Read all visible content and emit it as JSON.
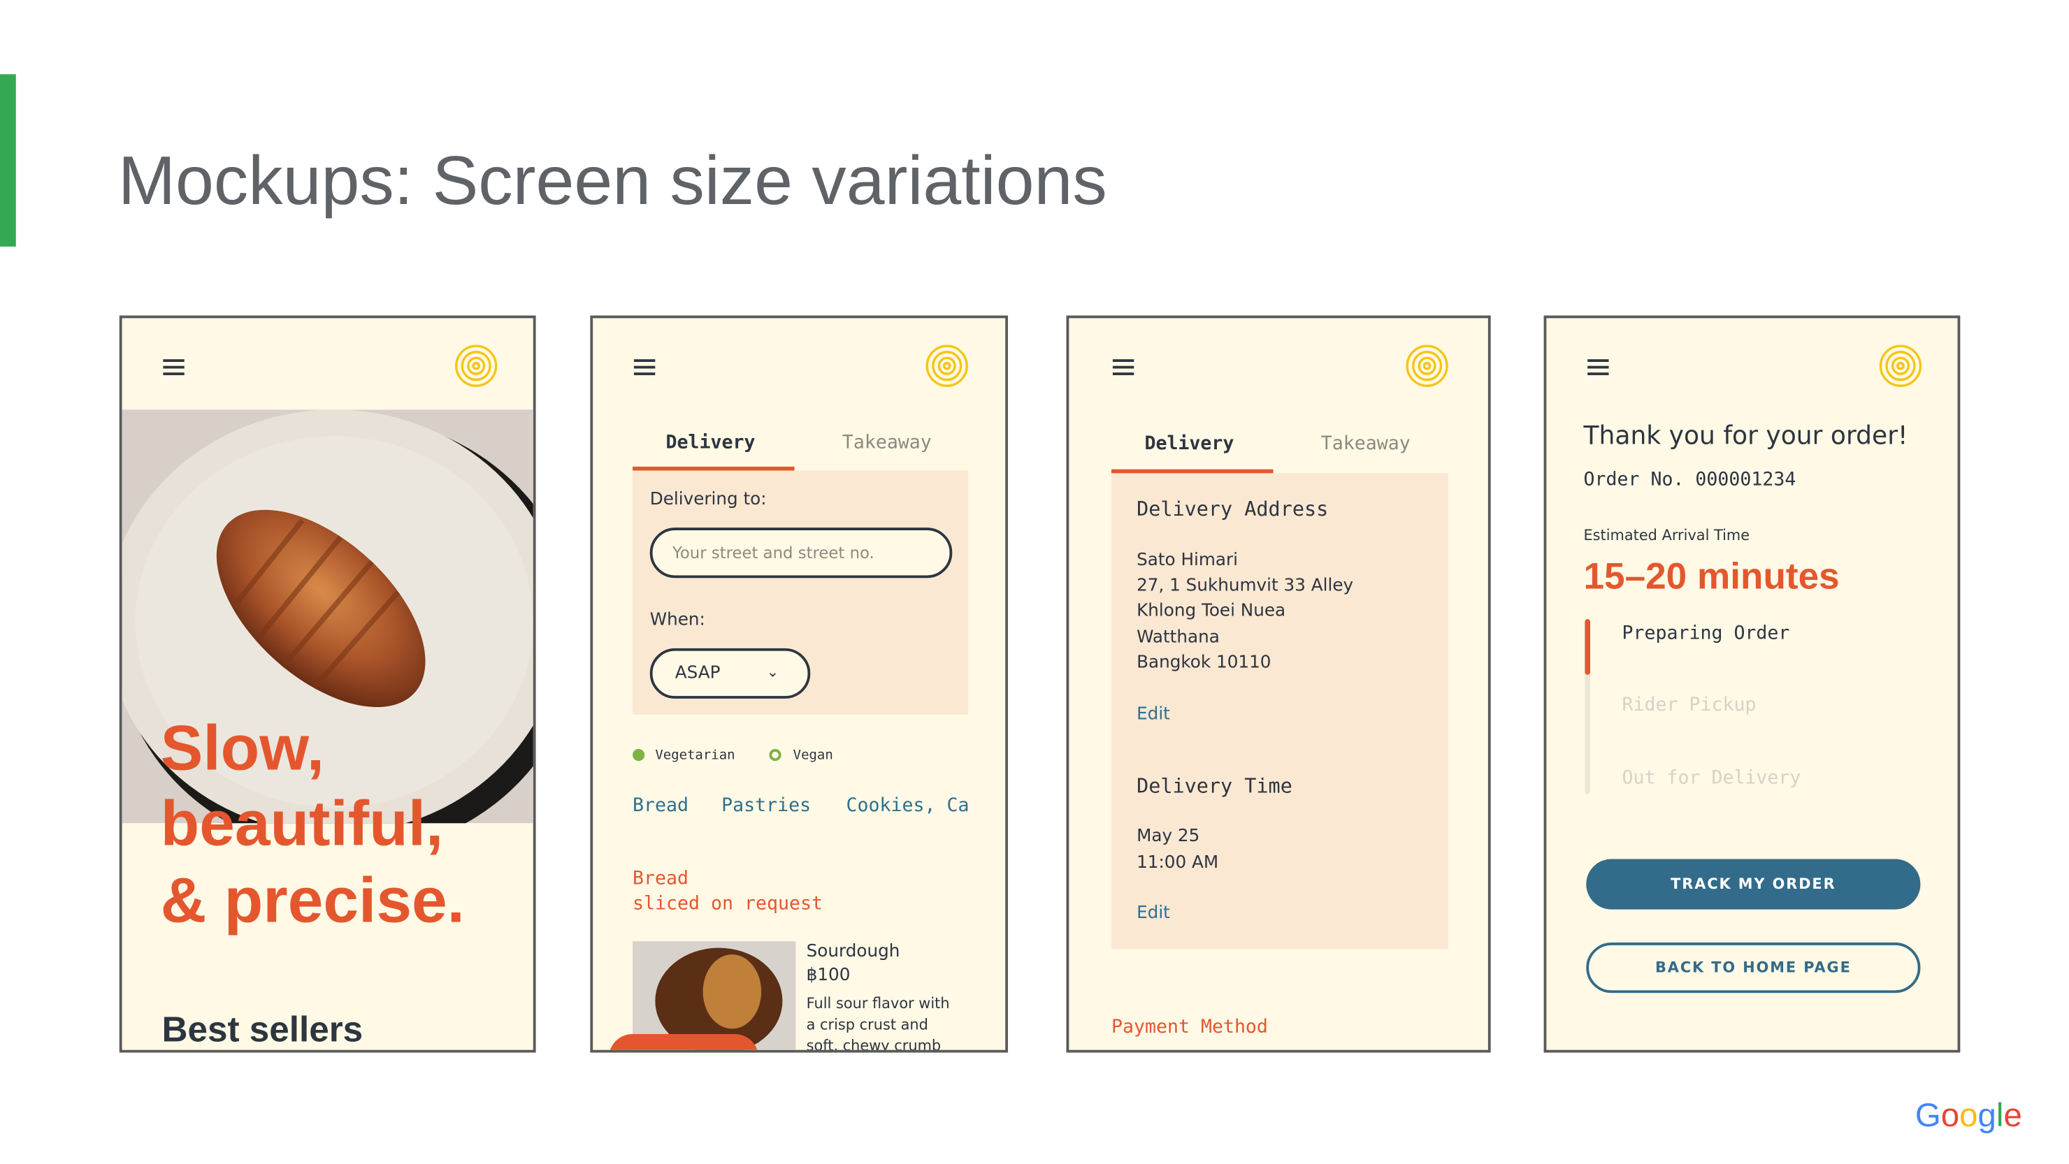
{
  "slide": {
    "title": "Mockups: Screen size variations",
    "accent_color": "#34a853",
    "footer_logo": "Google"
  },
  "colors": {
    "cream": "#fff9e6",
    "peach": "#fbe8d3",
    "orange": "#e4572e",
    "teal": "#336b8a",
    "logo_yellow": "#f5c518"
  },
  "phone1": {
    "menu_icon": "hamburger-icon",
    "logo_icon": "concentric-circles-logo",
    "hero_image": "croissant on plate",
    "headline": [
      "Slow,",
      "beautiful,",
      "& precise."
    ],
    "section_title": "Best sellers"
  },
  "phone2": {
    "tabs": [
      "Delivery",
      "Takeaway"
    ],
    "active_tab": "Delivery",
    "delivering_label": "Delivering to:",
    "address_placeholder": "Your street and street no.",
    "when_label": "When:",
    "when_value": "ASAP",
    "legend": [
      "Vegetarian",
      "Vegan"
    ],
    "categories": [
      "Bread",
      "Pastries",
      "Cookies, Ca"
    ],
    "section_title": "Bread",
    "section_subtitle": "sliced on request",
    "product": {
      "name": "Sourdough",
      "price": "฿100",
      "description": [
        "Full sour flavor with",
        "a crisp crust and",
        "soft, chewy crumb"
      ]
    }
  },
  "phone3": {
    "tabs": [
      "Delivery",
      "Takeaway"
    ],
    "active_tab": "Delivery",
    "address_heading": "Delivery Address",
    "address_lines": [
      "Sato Himari",
      "27, 1 Sukhumvit 33 Alley",
      "Khlong Toei Nuea",
      "Watthana",
      "Bangkok 10110"
    ],
    "edit_label": "Edit",
    "time_heading": "Delivery Time",
    "time_lines": [
      "May 25",
      "11:00 AM"
    ],
    "payment_heading": "Payment Method"
  },
  "phone4": {
    "thanks": "Thank you for your order!",
    "order_no": "Order No. 000001234",
    "eta_label": "Estimated Arrival Time",
    "eta_value": "15–20 minutes",
    "steps": [
      "Preparing Order",
      "Rider Pickup",
      "Out for Delivery"
    ],
    "current_step": 1,
    "track_button": "TRACK MY ORDER",
    "home_button": "BACK TO HOME PAGE"
  }
}
